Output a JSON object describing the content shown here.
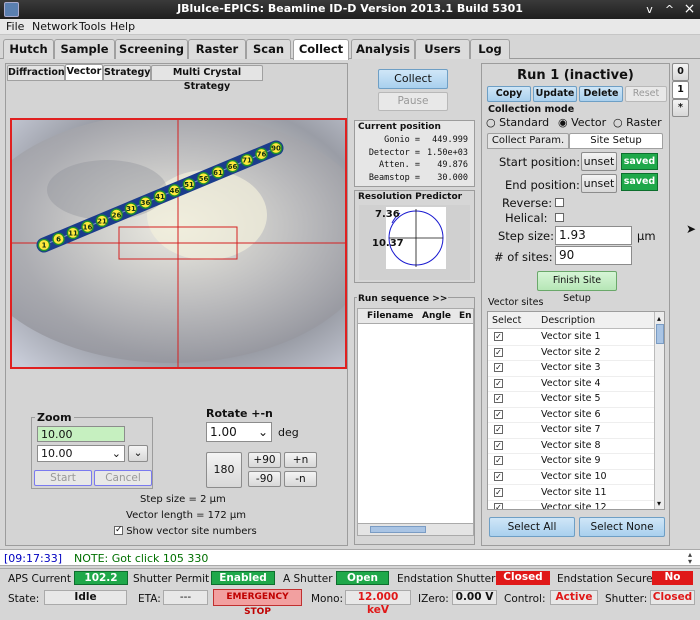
{
  "window": {
    "title": "JBluIce-EPICS: Beamline ID-D Version 2013.1 Build 5301",
    "minimize": "v",
    "maximize": "^",
    "close": "×"
  },
  "menu": [
    "File",
    "Network",
    "Tools",
    "Help"
  ],
  "main_tabs": [
    "Hutch",
    "Sample",
    "Screening",
    "Raster",
    "Scan",
    "Collect",
    "Analysis",
    "Users",
    "Log"
  ],
  "active_tab": "Collect",
  "sub_tabs": [
    "Diffraction",
    "Vector",
    "Strategy",
    "Multi Crystal Strategy"
  ],
  "active_sub_tab": "Vector",
  "video": {
    "sites": [
      "1",
      "6",
      "11",
      "16",
      "21",
      "26",
      "31",
      "36",
      "41",
      "46",
      "51",
      "56",
      "61",
      "66",
      "71",
      "76",
      "90"
    ]
  },
  "zoom": {
    "label": "Zoom",
    "value": "10.00",
    "select_value": "10.00",
    "start": "Start",
    "cancel": "Cancel"
  },
  "rotate": {
    "label": "Rotate +-n",
    "value": "1.00",
    "unit": "deg",
    "b180": "180",
    "b_plus90": "+90",
    "b_minus90": "-90",
    "b_plusn": "+n",
    "b_minusn": "-n"
  },
  "vector_info": {
    "step_size": "Step size = 2 μm",
    "vector_length": "Vector length = 172 μm",
    "show_numbers": "Show vector site numbers"
  },
  "middle": {
    "collect": "Collect",
    "pause": "Pause",
    "current_position_title": "Current position",
    "positions": [
      {
        "label": "Gonio =",
        "value": "449.999"
      },
      {
        "label": "Detector =",
        "value": "1.50e+03"
      },
      {
        "label": "Atten. =",
        "value": "49.876"
      },
      {
        "label": "Beamstop =",
        "value": "30.000"
      }
    ],
    "resolution_title": "Resolution Predictor",
    "res_outer": "7.36",
    "res_inner": "10.37",
    "run_sequence_title": "Run sequence >>",
    "run_columns": [
      "Filename",
      "Angle",
      "En"
    ]
  },
  "run": {
    "title": "Run 1 (inactive)",
    "buttons": [
      "Copy",
      "Update",
      "Delete",
      "Reset"
    ],
    "collection_mode_label": "Collection mode",
    "modes": [
      "Standard",
      "Vector",
      "Raster"
    ],
    "selected_mode": "Vector",
    "tabs": [
      "Collect Param.",
      "Site Setup"
    ],
    "start_position_label": "Start position:",
    "end_position_label": "End position:",
    "unset": "unset",
    "saved": "saved",
    "reverse_label": "Reverse:",
    "helical_label": "Helical:",
    "step_size_label": "Step size:",
    "step_size_value": "1.93",
    "step_unit": "μm",
    "sites_label": "# of sites:",
    "sites_value": "90",
    "finish": "Finish Site Setup",
    "vector_sites_title": "Vector sites",
    "col_select": "Select",
    "col_description": "Description",
    "sites": [
      "Vector site 1",
      "Vector site 2",
      "Vector site 3",
      "Vector site 4",
      "Vector site 5",
      "Vector site 6",
      "Vector site 7",
      "Vector site 8",
      "Vector site 9",
      "Vector site 10",
      "Vector site 11",
      "Vector site 12"
    ],
    "select_all": "Select All",
    "select_none": "Select None",
    "run_tabs": [
      "0",
      "1",
      "*"
    ]
  },
  "log_line": {
    "time": "[09:17:33]",
    "message": "NOTE: Got click 105 330"
  },
  "status": {
    "aps_current_label": "APS Current",
    "aps_current": "102.2",
    "shutter_permit_label": "Shutter Permit",
    "shutter_permit": "Enabled",
    "a_shutter_label": "A Shutter",
    "a_shutter": "Open",
    "endstation_shutter_label": "Endstation Shutter",
    "endstation_shutter": "Closed",
    "endstation_secure_label": "Endstation Secure",
    "endstation_secure": "No",
    "state_label": "State:",
    "state": "Idle",
    "eta_label": "ETA:",
    "eta": "---",
    "emergency_stop": "EMERGENCY STOP",
    "mono_label": "Mono:",
    "mono": "12.000 keV",
    "izero_label": "IZero:",
    "izero": "0.00 V",
    "control_label": "Control:",
    "control": "Active",
    "shutter_label": "Shutter:",
    "shutter": "Closed"
  },
  "colors": {
    "green": "#1fa84a",
    "red": "#e01818",
    "blue_button": "#a9d0ee",
    "video_border": "#e02020",
    "vector_line": "#1a3c8c"
  }
}
